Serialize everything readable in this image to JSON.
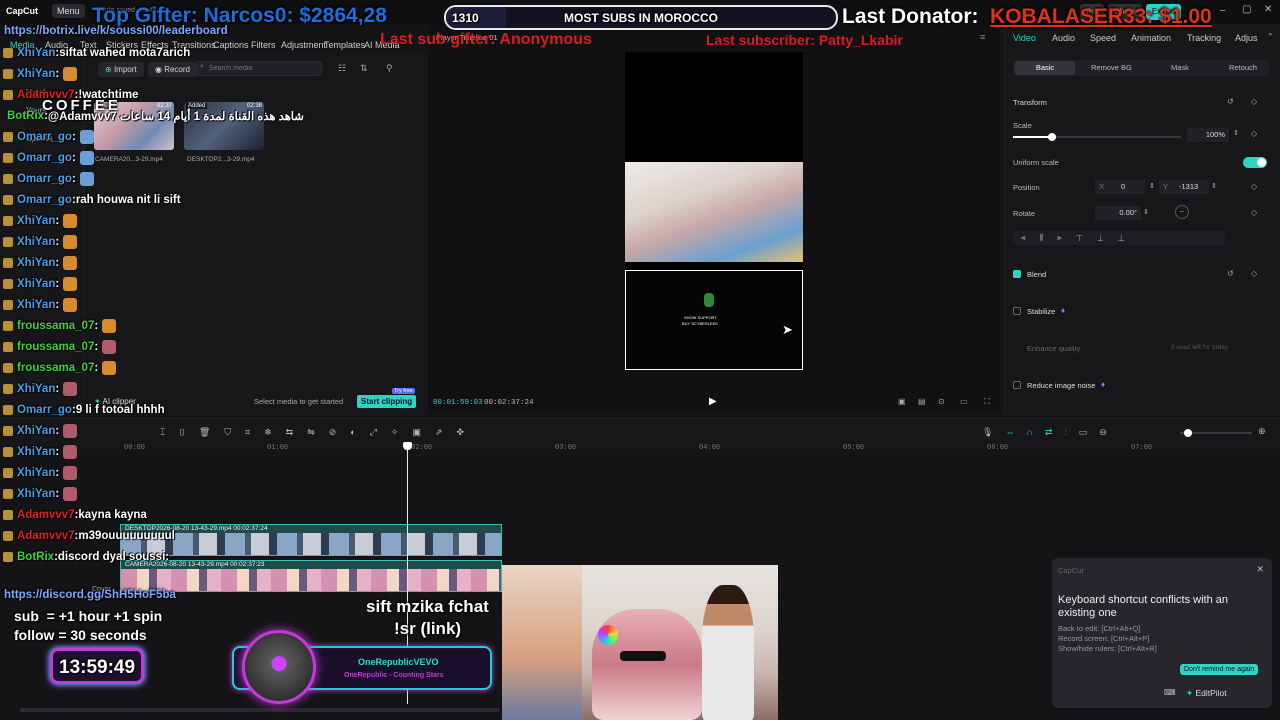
{
  "app": {
    "logo": "CapCut",
    "menu_label": "Menu",
    "autosave": "Auto saved: 13:43:30",
    "top_buttons": [
      "Pro",
      "Share",
      "Export"
    ]
  },
  "overlay": {
    "top_gifter": "Top Gifter: Narcos0: $2864,28",
    "sub_goal_count": "1310",
    "sub_goal_label": "MOST SUBS IN MOROCCO",
    "last_donator_prefix": "Last Donator: ",
    "last_donator_name": "KOBALASER33: $1.00",
    "last_sub_gifter": "Last sub gifter: Anonymous",
    "last_subscriber": "Last subscriber: Patty_Lkabir",
    "leaderboard_link": "https://botrix.live/k/soussi00/leaderboard",
    "coffee_text": "COFFEE",
    "discord_link": "https://discord.gg/ShH5HoF5ba",
    "sub_rule": "sub  = +1 hour +1 spin",
    "follow_rule": "follow = 30 seconds",
    "timer": "13:59:49",
    "song_channel": "OneRepublicVEVO",
    "song_title": "OneRepublic - Counting Stars",
    "song_cmd_1": "sift mzika fchat",
    "song_cmd_2": "!sr (link)"
  },
  "chat": [
    {
      "user": "XhiYan",
      "msg": "siftat wahed mota7arich",
      "color": "#4a9ee8",
      "emote": ""
    },
    {
      "user": "XhiYan",
      "msg": "",
      "color": "#4a9ee8",
      "emote": "o"
    },
    {
      "user": "Adamvvv7",
      "msg": "!watchtime",
      "color": "#e02020",
      "emote": ""
    },
    {
      "user": "BotRix",
      "msg": "@Adamvvv7 شاهد هذه القناة لمدة 1 أيام 14 ساعات",
      "color": "#3ed43e",
      "emote": ""
    },
    {
      "user": "Omarr_go",
      "msg": "",
      "color": "#4a9ee8",
      "emote": "b"
    },
    {
      "user": "Omarr_go",
      "msg": "",
      "color": "#4a9ee8",
      "emote": "b"
    },
    {
      "user": "Omarr_go",
      "msg": "",
      "color": "#4a9ee8",
      "emote": "b"
    },
    {
      "user": "Omarr_go",
      "msg": "rah houwa nit li sift",
      "color": "#4a9ee8",
      "emote": ""
    },
    {
      "user": "XhiYan",
      "msg": "",
      "color": "#4a9ee8",
      "emote": "o"
    },
    {
      "user": "XhiYan",
      "msg": "",
      "color": "#4a9ee8",
      "emote": "o"
    },
    {
      "user": "XhiYan",
      "msg": "",
      "color": "#4a9ee8",
      "emote": "o"
    },
    {
      "user": "XhiYan",
      "msg": "",
      "color": "#4a9ee8",
      "emote": "o"
    },
    {
      "user": "XhiYan",
      "msg": "",
      "color": "#4a9ee8",
      "emote": "o"
    },
    {
      "user": "froussama_07",
      "msg": "",
      "color": "#3ed43e",
      "emote": "o"
    },
    {
      "user": "froussama_07",
      "msg": "",
      "color": "#3ed43e",
      "emote": "p"
    },
    {
      "user": "froussama_07",
      "msg": "",
      "color": "#3ed43e",
      "emote": "o"
    },
    {
      "user": "XhiYan",
      "msg": "",
      "color": "#4a9ee8",
      "emote": "p"
    },
    {
      "user": "Omarr_go",
      "msg": "9 li f totoal hhhh",
      "color": "#4a9ee8",
      "emote": ""
    },
    {
      "user": "XhiYan",
      "msg": "",
      "color": "#4a9ee8",
      "emote": "p"
    },
    {
      "user": "XhiYan",
      "msg": "",
      "color": "#4a9ee8",
      "emote": "p"
    },
    {
      "user": "XhiYan",
      "msg": "",
      "color": "#4a9ee8",
      "emote": "p"
    },
    {
      "user": "XhiYan",
      "msg": "",
      "color": "#4a9ee8",
      "emote": "p"
    },
    {
      "user": "Adamvvv7",
      "msg": "kayna kayna",
      "color": "#e02020",
      "emote": ""
    },
    {
      "user": "Adamvvv7",
      "msg": "m39ouuuuuuuuul",
      "color": "#e02020",
      "emote": ""
    },
    {
      "user": "BotRix",
      "msg": "discord dyal soussi:",
      "color": "#3ed43e",
      "emote": ""
    }
  ],
  "toolstrip": [
    "Media",
    "Audio",
    "Text",
    "Stickers",
    "Effects",
    "Transitions",
    "Captions",
    "Filters",
    "Adjustment",
    "Templates",
    "AI Media"
  ],
  "media": {
    "import_label": "Import",
    "record_label": "Record",
    "search_placeholder": "Search media",
    "sidebar": [
      "Local",
      "Yours",
      "Spaces"
    ],
    "clips": [
      {
        "name": "CAMERA20...3-29.mp4",
        "badge": "Added",
        "dur": "02:37"
      },
      {
        "name": "DESKTOP2...3-29.mp4",
        "badge": "Added",
        "dur": "02:38"
      }
    ],
    "ai_clipper": "AI clipper",
    "select_hint": "Select media to get started",
    "start_clipping": "Start clipping",
    "try_free": "Try free"
  },
  "player": {
    "title": "Player Timeline 01",
    "time_current": "00:01:59:03",
    "time_total": "00:02:37:24",
    "screen_text_1": "SHOW SUPPORT",
    "screen_text_2": "BUY SCYBERLEEK"
  },
  "props": {
    "tabs": [
      "Video",
      "Audio",
      "Speed",
      "Animation",
      "Tracking",
      "Adjus"
    ],
    "subtabs": [
      "Basic",
      "Remove BG",
      "Mask",
      "Retouch"
    ],
    "transform_label": "Transform",
    "scale_label": "Scale",
    "scale_value": "100%",
    "scale_level": 0.1,
    "uniform_label": "Uniform scale",
    "position_label": "Position",
    "pos_x_label": "X",
    "pos_x": "0",
    "pos_y_label": "Y",
    "pos_y": "-1313",
    "rotate_label": "Rotate",
    "rotate_value": "0.00°",
    "blend_label": "Blend",
    "stabilize_label": "Stabilize",
    "enhance_label": "Enhance quality",
    "enhance_note": "3 used left for today",
    "reduce_label": "Reduce image noise"
  },
  "timeline": {
    "ticks": [
      "00:00",
      "01:00",
      "02:00",
      "03:00",
      "04:00",
      "05:00",
      "06:00",
      "07:00"
    ],
    "clip1_label": "DESKTOP2026-08-20 13-43-29.mp4   00:02:37:24",
    "clip2_label": "CAMERA2026-08-20 13-43-29.mp4   00:02:37:23",
    "cover_label": "Cover"
  },
  "toast": {
    "app": "CapCut",
    "title": "Keyboard shortcut conflicts with an existing one",
    "line1": "Back to edit: [Ctrl+Alt+Q]",
    "line2": "Record screen: [Ctrl+Alt+P]",
    "line3": "Show/hide rulers: [Ctrl+Alt+R]",
    "dismiss": "Don't remind me again",
    "editpilot": "EditPilot"
  },
  "colors": {
    "accent": "#2fd3c3",
    "donator": "#e0301e",
    "overlay_red": "#d81e1e",
    "sub_green": "#25c9b5"
  }
}
